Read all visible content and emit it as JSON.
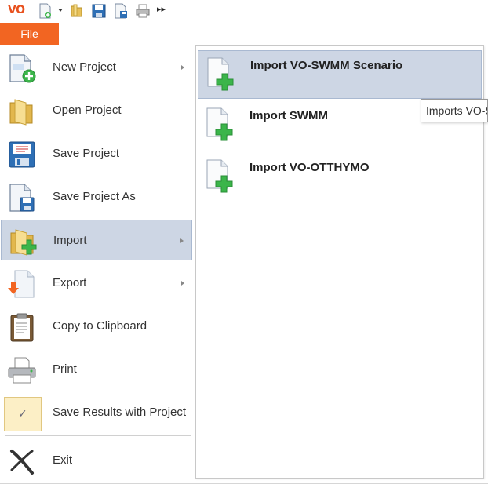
{
  "app": {
    "logo": "VO"
  },
  "toolbar": {
    "icons": [
      "new-document-icon",
      "open-folder-icon",
      "save-icon",
      "save-as-icon",
      "print-icon",
      "more-icon"
    ],
    "more_glyph": "▸▸"
  },
  "tabs": {
    "file": "File"
  },
  "menu": {
    "items": [
      {
        "label": "New Project",
        "icon": "new-project-icon",
        "has_submenu": true
      },
      {
        "label": "Open Project",
        "icon": "folder-icon",
        "has_submenu": false
      },
      {
        "label": "Save Project",
        "icon": "floppy-disk-icon",
        "has_submenu": false
      },
      {
        "label": "Save Project As",
        "icon": "save-as-icon",
        "has_submenu": false
      },
      {
        "label": "Import",
        "icon": "folder-add-icon",
        "has_submenu": true,
        "active": true
      },
      {
        "label": "Export",
        "icon": "export-icon",
        "has_submenu": true
      },
      {
        "label": "Copy to Clipboard",
        "icon": "clipboard-icon",
        "has_submenu": false
      },
      {
        "label": "Print",
        "icon": "printer-icon",
        "has_submenu": false
      },
      {
        "label": "Save Results with Project",
        "icon": "checkmark-icon",
        "has_submenu": false,
        "checked": true
      },
      {
        "label": "Exit",
        "icon": "exit-x-icon",
        "has_submenu": false
      }
    ]
  },
  "submenu": {
    "items": [
      {
        "label": "Import VO-SWMM Scenario",
        "icon": "document-add-icon",
        "active": true
      },
      {
        "label": "Import SWMM",
        "icon": "document-add-icon"
      },
      {
        "label": "Import VO-OTTHYMO",
        "icon": "document-add-icon"
      }
    ]
  },
  "tooltip": {
    "text": "Imports VO-SWMM Scenario"
  },
  "colors": {
    "accent": "#f26522",
    "selection": "#cdd6e4",
    "check_bg": "#fcefc6",
    "plus_green": "#3bb54a"
  }
}
